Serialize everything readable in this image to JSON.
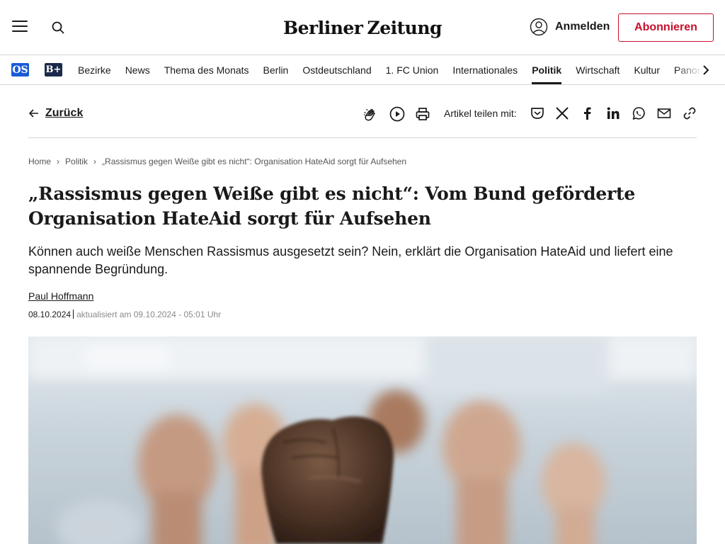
{
  "header": {
    "logo_text_left": "Berliner",
    "logo_text_right": "Zeitung",
    "login_label": "Anmelden",
    "subscribe_label": "Abonnieren"
  },
  "nav": {
    "badges": [
      "OS",
      "B+"
    ],
    "items": [
      {
        "label": "Bezirke",
        "active": false
      },
      {
        "label": "News",
        "active": false
      },
      {
        "label": "Thema des Monats",
        "active": false
      },
      {
        "label": "Berlin",
        "active": false
      },
      {
        "label": "Ostdeutschland",
        "active": false
      },
      {
        "label": "1. FC Union",
        "active": false
      },
      {
        "label": "Internationales",
        "active": false
      },
      {
        "label": "Politik",
        "active": true
      },
      {
        "label": "Wirtschaft",
        "active": false
      },
      {
        "label": "Kultur",
        "active": false
      },
      {
        "label": "Panorama",
        "active": false
      }
    ]
  },
  "toolbar": {
    "back_label": "Zurück",
    "share_label": "Artikel teilen mit:",
    "icons": [
      "clap-icon",
      "play-icon",
      "print-icon",
      "pocket-icon",
      "x-icon",
      "facebook-icon",
      "linkedin-icon",
      "whatsapp-icon",
      "mail-icon",
      "link-icon"
    ]
  },
  "breadcrumb": {
    "items": [
      "Home",
      "Politik",
      "„Rassismus gegen Weiße gibt es nicht“: Organisation HateAid sorgt für Aufsehen"
    ]
  },
  "article": {
    "headline": "„Rassismus gegen Weiße gibt es nicht“: Vom Bund geförderte Organisation HateAid sorgt für Aufsehen",
    "teaser": "Können auch weiße Menschen Rassismus ausgesetzt sein? Nein, erklärt die Organisation HateAid und liefert eine spannende Begründung.",
    "author": "Paul Hoffmann",
    "published": "08.10.2024",
    "updated": "aktualisiert am 09.10.2024 - 05:01 Uhr"
  },
  "colors": {
    "accent": "#c8102e",
    "os_badge": "#1a5bd6",
    "bplus_badge": "#1b2a4a"
  }
}
